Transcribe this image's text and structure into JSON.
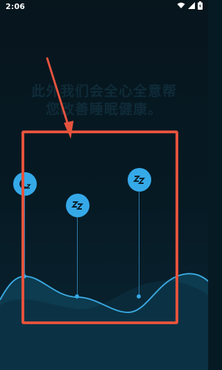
{
  "status_bar": {
    "time": "2:06",
    "icons": [
      "wifi-icon",
      "signal-icon",
      "battery-icon"
    ],
    "text_color": "#ffffff"
  },
  "background_text": "此外我们会全心全意帮您改善睡眠健康。",
  "sleep_pins": [
    {
      "icon": "sleep-start-icon"
    },
    {
      "icon": "sleep-zz-icon"
    },
    {
      "icon": "sleep-zz-icon"
    }
  ],
  "colors": {
    "background": "#061a24",
    "wave_fill": "#0d3b4f",
    "wave_line": "#3aa8e0",
    "pin": "#35a9e8",
    "annotation": "#e6533d"
  }
}
